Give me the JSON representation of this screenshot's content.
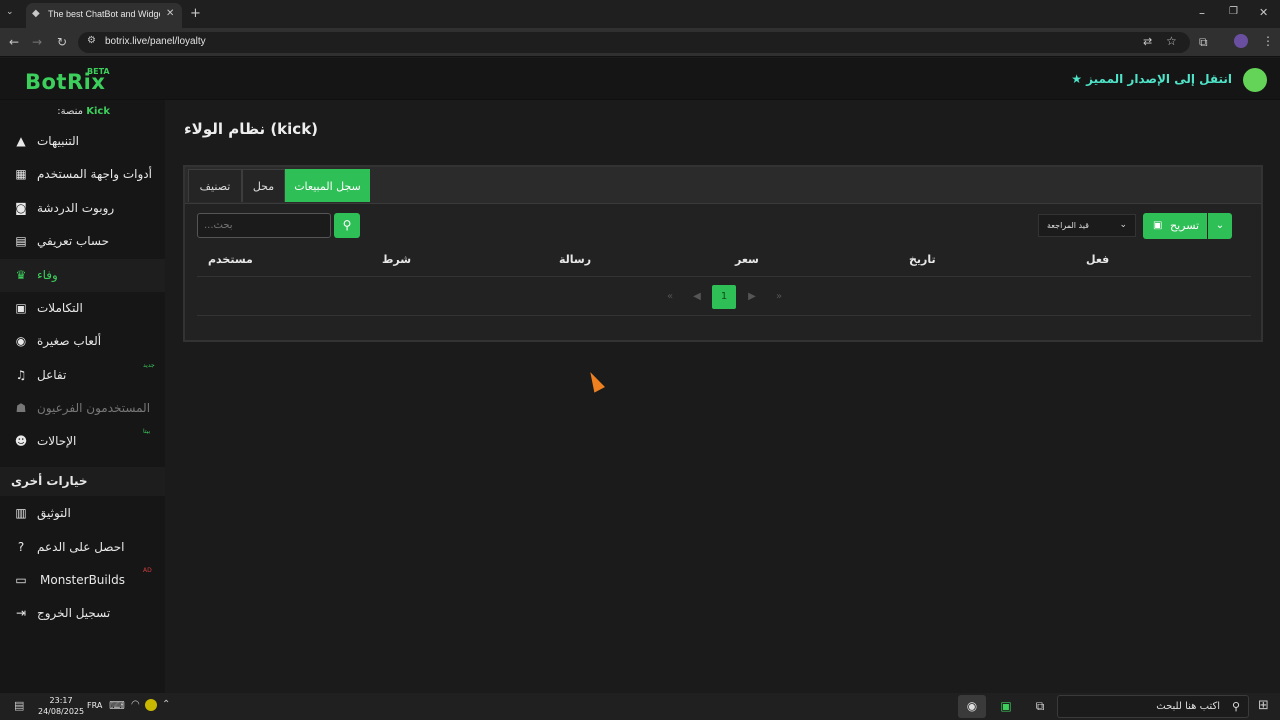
{
  "browser": {
    "tab_title": "The best ChatBot and Widgets",
    "url": "botrix.live/panel/loyalty"
  },
  "header": {
    "logo": "BotRix",
    "beta": "BETA",
    "premium_link": "انتقل إلى الإصدار المميز"
  },
  "sidebar": {
    "platform_label": "منصة:",
    "platform_value": "Kick",
    "items": [
      {
        "label": "التنبيهات",
        "icon": "warning-icon"
      },
      {
        "label": "أدوات واجهة المستخدم",
        "icon": "widgets-icon"
      },
      {
        "label": "روبوت الدردشة",
        "icon": "robot-icon"
      },
      {
        "label": "حساب تعريفي",
        "icon": "profile-card-icon"
      },
      {
        "label": "وفاء",
        "icon": "trophy-icon"
      },
      {
        "label": "التكاملات",
        "icon": "integrations-icon"
      },
      {
        "label": "ألعاب صغيرة",
        "icon": "gamepad-icon"
      },
      {
        "label": "تفاعل",
        "icon": "music-icon",
        "badge": "جديد"
      },
      {
        "label": "المستخدمون الفرعيون",
        "icon": "users-icon"
      },
      {
        "label": "الإحالات",
        "icon": "referrals-icon",
        "badge": "بيتا"
      }
    ],
    "other_options": "خيارات أخرى",
    "other_items": [
      {
        "label": "التوثيق",
        "icon": "docs-icon"
      },
      {
        "label": "احصل على الدعم",
        "icon": "help-icon"
      },
      {
        "label": "MonsterBuilds",
        "icon": "laptop-icon",
        "badge": "AD"
      },
      {
        "label": "تسجيل الخروج",
        "icon": "logout-icon"
      }
    ]
  },
  "main": {
    "title": "نظام الولاء (kick)",
    "tabs": [
      "سجل المبيعات",
      "محل",
      "تصنيف"
    ],
    "search_placeholder": "بحث...",
    "filter_label": "قيد المراجعة",
    "export_label": "تسريح",
    "columns": [
      "مستخدم",
      "شرط",
      "رسالة",
      "سعر",
      "تاريخ",
      "فعل"
    ],
    "current_page": "1"
  },
  "taskbar": {
    "time": "23:17",
    "date": "24/08/2025",
    "lang": "FRA",
    "search_placeholder": "اكتب هنا للبحث"
  }
}
